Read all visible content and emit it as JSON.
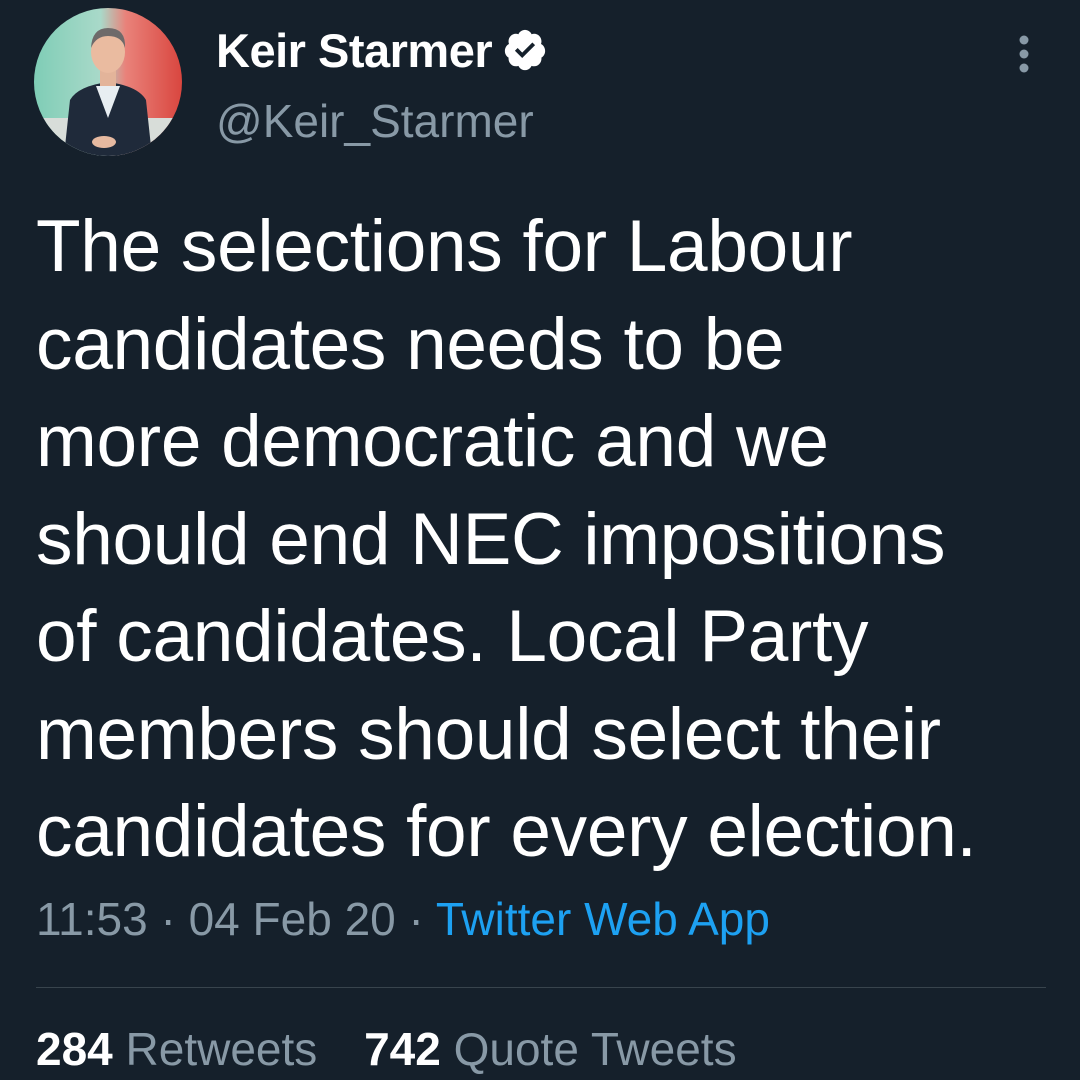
{
  "author": {
    "display_name": "Keir Starmer",
    "handle": "@Keir_Starmer",
    "verified": true,
    "avatar_icon": "profile-photo"
  },
  "tweet": {
    "lines": [
      "The selections for Labour",
      "candidates needs to be",
      "more democratic and we",
      "should end NEC impositions",
      "of candidates. Local Party",
      "members should select their",
      "candidates for every election."
    ]
  },
  "meta": {
    "time": "11:53",
    "separator": "·",
    "date": "04 Feb 20",
    "source": "Twitter Web App"
  },
  "stats": {
    "retweets_count": "284",
    "retweets_label": "Retweets",
    "quote_count": "742",
    "quote_label": "Quote Tweets"
  },
  "colors": {
    "background": "#15202b",
    "text": "#ffffff",
    "secondary": "#8899a6",
    "link": "#1da1f2",
    "divider": "#38444d"
  }
}
